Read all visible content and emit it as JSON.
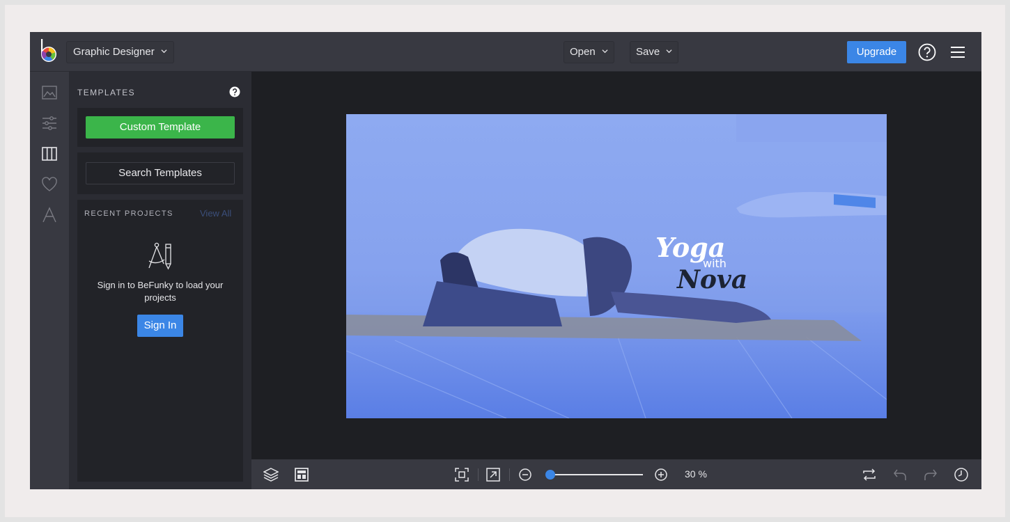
{
  "header": {
    "app_mode": "Graphic Designer",
    "open_label": "Open",
    "save_label": "Save",
    "upgrade_label": "Upgrade"
  },
  "rail": {
    "items": [
      "image-icon",
      "sliders-icon",
      "columns-icon",
      "heart-icon",
      "text-icon"
    ],
    "active_index": 2
  },
  "templates_panel": {
    "title": "TEMPLATES",
    "custom_template_label": "Custom Template",
    "search_templates_label": "Search Templates",
    "recent_projects_label": "RECENT PROJECTS",
    "view_all_label": "View All",
    "signin_message": "Sign in to BeFunky to load your projects",
    "signin_button_label": "Sign In"
  },
  "canvas": {
    "overlay_color": "#5b7fe6",
    "title_word": "Yoga",
    "middle_word": "with",
    "name_word": "Nova"
  },
  "bottom_toolbar": {
    "zoom_value": "30 %",
    "zoom_fraction": 0.0
  },
  "colors": {
    "accent_blue": "#3b86e6",
    "green": "#3bb54a",
    "topbar": "#383941",
    "panel": "#2b2c33"
  }
}
